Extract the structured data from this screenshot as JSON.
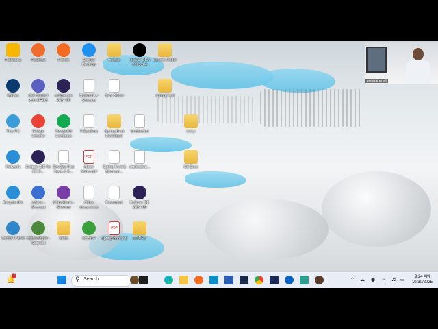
{
  "desktop": {
    "icons": [
      {
        "label": "Pathirana",
        "type": "user",
        "color": "#f5b700"
      },
      {
        "label": "Postman",
        "type": "app",
        "color": "#ef6c2b"
      },
      {
        "label": "Firefox",
        "type": "app",
        "color": "#f36b21"
      },
      {
        "label": "Docker Desktop",
        "type": "app",
        "color": "#1f8ff0"
      },
      {
        "label": "Images",
        "type": "folder"
      },
      {
        "label": "IntelliJ IDEA 2023.3.4",
        "type": "app",
        "color": "#000000"
      },
      {
        "label": "Source Folder",
        "type": "folder"
      },
      {
        "label": "Webex",
        "type": "app",
        "color": "#0a3a70"
      },
      {
        "label": "Get Started with ORDS",
        "type": "app",
        "color": "#5a5fc2"
      },
      {
        "label": "eclipse jee 2024-06",
        "type": "app",
        "color": "#2c2255"
      },
      {
        "label": "Notepad++ Shortcut",
        "type": "doc"
      },
      {
        "label": "Java Notes",
        "type": "doc"
      },
      {
        "label": "spring-boot",
        "type": "folder"
      },
      {
        "label": "This PC",
        "type": "app",
        "color": "#3a9cd8"
      },
      {
        "label": "Google Chrome",
        "type": "app",
        "color": "#ea4335"
      },
      {
        "label": "MongoDB Compass",
        "type": "app",
        "color": "#13aa52"
      },
      {
        "label": "HELLO.txt",
        "type": "doc"
      },
      {
        "label": "Spring Boot Developer",
        "type": "folder"
      },
      {
        "label": "Untitled.txt",
        "type": "doc"
      },
      {
        "label": "temp",
        "type": "folder"
      },
      {
        "label": "Network",
        "type": "app",
        "color": "#2a8fd6"
      },
      {
        "label": "Eclipse IDE for EE D...",
        "type": "app",
        "color": "#2c2255"
      },
      {
        "label": "DevOps Run Book & O...",
        "type": "doc"
      },
      {
        "label": "Alison Notes.pdf",
        "type": "pdf"
      },
      {
        "label": "Spring Boot & Microser...",
        "type": "doc"
      },
      {
        "label": "application...",
        "type": "doc"
      },
      {
        "label": "Git Docs",
        "type": "folder"
      },
      {
        "label": "Recycle Bin",
        "type": "app",
        "color": "#2b8fd8"
      },
      {
        "label": "eclipse - Shortcut",
        "type": "app",
        "color": "#3b6fd1"
      },
      {
        "label": "MobaXterm - Shortcut",
        "type": "app",
        "color": "#7a3ea8"
      },
      {
        "label": "Other documents",
        "type": "doc"
      },
      {
        "label": "Document",
        "type": "doc"
      },
      {
        "label": "Eclipse IDE 2024-09",
        "type": "app",
        "color": "#2c2255"
      },
      {
        "label": "Control Panel",
        "type": "app",
        "color": "#2f86c9"
      },
      {
        "label": "sqldeveloper - Shortcut",
        "type": "app",
        "color": "#4a8a3a"
      },
      {
        "label": "Ideas",
        "type": "folder"
      },
      {
        "label": "winSCP",
        "type": "app",
        "color": "#3aa03c"
      },
      {
        "label": "Spring Boot.pdf",
        "type": "pdf"
      },
      {
        "label": "CODES",
        "type": "folder"
      }
    ]
  },
  "webcam": {
    "caption": "melaraj er nit"
  },
  "taskbar": {
    "search_placeholder": "Search",
    "notification_count": "7",
    "time": "9:24 AM",
    "date": "10/30/2025"
  }
}
